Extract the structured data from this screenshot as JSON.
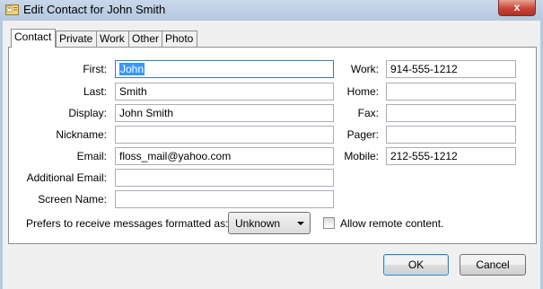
{
  "window": {
    "title": "Edit Contact for John Smith",
    "close_glyph": "x"
  },
  "tabs": [
    {
      "label": "Contact",
      "active": true
    },
    {
      "label": "Private",
      "active": false
    },
    {
      "label": "Work",
      "active": false
    },
    {
      "label": "Other",
      "active": false
    },
    {
      "label": "Photo",
      "active": false
    }
  ],
  "left_fields": [
    {
      "label": "First:",
      "value": "John"
    },
    {
      "label": "Last:",
      "value": "Smith"
    },
    {
      "label": "Display:",
      "value": "John Smith"
    },
    {
      "label": "Nickname:",
      "value": ""
    },
    {
      "label": "Email:",
      "value": "floss_mail@yahoo.com"
    },
    {
      "label": "Additional Email:",
      "value": ""
    },
    {
      "label": "Screen Name:",
      "value": ""
    }
  ],
  "right_fields": [
    {
      "label": "Work:",
      "value": "914-555-1212"
    },
    {
      "label": "Home:",
      "value": ""
    },
    {
      "label": "Fax:",
      "value": ""
    },
    {
      "label": "Pager:",
      "value": ""
    },
    {
      "label": "Mobile:",
      "value": "212-555-1212"
    }
  ],
  "format": {
    "label": "Prefers to receive messages formatted as:",
    "selected": "Unknown"
  },
  "remote_content": {
    "label": "Allow remote content.",
    "checked": false
  },
  "buttons": {
    "ok": "OK",
    "cancel": "Cancel"
  },
  "colors": {
    "selection": "#3399ff",
    "close": "#c8453a",
    "titlebar": "#b4c8df"
  }
}
